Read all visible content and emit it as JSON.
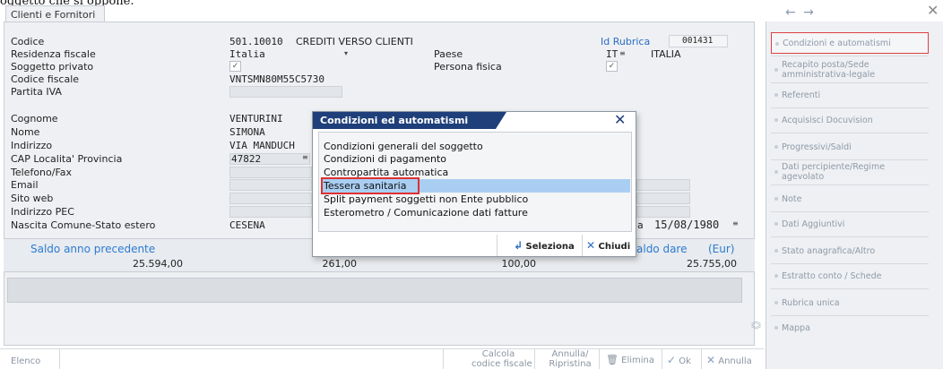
{
  "page_overflow_text": "oggetto che si oppone.",
  "window": {
    "tab_title": "Clienti e Fornitori",
    "nav_arrows": "← →",
    "close_glyph": "✕"
  },
  "form": {
    "codice_label": "Codice",
    "codice_value": "501.10010",
    "codice_desc": "CREDITI VERSO CLIENTI",
    "id_rubrica_label": "Id Rubrica",
    "id_rubrica_value": "001431",
    "residenza_label": "Residenza fiscale",
    "residenza_value": "Italia",
    "paese_label": "Paese",
    "paese_code": "IT",
    "paese_name": "ITALIA",
    "soggetto_privato_label": "Soggetto privato",
    "persona_fisica_label": "Persona fisica",
    "check_mark": "✓",
    "codice_fiscale_label": "Codice fiscale",
    "codice_fiscale_value": "VNTSMN80M55C5730",
    "partita_iva_label": "Partita IVA",
    "cognome_label": "Cognome",
    "cognome_value": "VENTURINI",
    "nome_label": "Nome",
    "nome_value": "SIMONA",
    "indirizzo_label": "Indirizzo",
    "indirizzo_value": "VIA MANDUCH",
    "cap_label": "CAP Localita' Provincia",
    "cap_value": "47822",
    "telefono_label": "Telefono/Fax",
    "email_label": "Email",
    "sito_label": "Sito web",
    "pec_label": "Indirizzo PEC",
    "nascita_label": "Nascita Comune-Stato estero",
    "nascita_value": "CESENA",
    "nascita_date_prefix": "a",
    "nascita_date": "15/08/1980"
  },
  "saldo": {
    "anno_prec_label": "Saldo anno precedente",
    "anno_prec_value": "25.594,00",
    "val2": "261,00",
    "val3": "100,00",
    "saldo_dare_label": "aldo dare",
    "currency_label": "(Eur)",
    "saldo_dare_value": "25.755,00"
  },
  "dialog": {
    "title": "Condizioni ed automatismi",
    "close_glyph": "✕",
    "items": [
      "Condizioni generali del soggetto",
      "Condizioni di pagamento",
      "Contropartita automatica",
      "Tessera sanitaria",
      "Split payment soggetti non Ente pubblico",
      "Esterometro / Comunicazione dati fatture"
    ],
    "selected_index": 3,
    "seleziona_label": "Seleziona",
    "chiudi_label": "Chiudi"
  },
  "right_menu": [
    "Condizioni e automatismi",
    "Recapito posta/Sede amministrativa-legale",
    "Referenti",
    "Acquisisci Docuvision",
    "Progressivi/Saldi",
    "Dati percipiente/Regime agevolato",
    "Note",
    "Dati Aggiuntivi",
    "Stato anagrafica/Altro",
    "Estratto conto / Schede",
    "Rubrica unica",
    "Mappa"
  ],
  "bottom_bar": {
    "elenco": "Elenco",
    "calcola_1": "Calcola",
    "calcola_2": "codice fiscale",
    "annulla_ripristina_1": "Annulla/",
    "annulla_ripristina_2": "Ripristina",
    "elimina": "Elimina",
    "ok": "Ok",
    "annulla": "Annulla"
  },
  "colors": {
    "accent": "#1e3f7a",
    "selection": "#a9cef2",
    "highlight_border": "#e03030",
    "link": "#2b6cc4"
  }
}
